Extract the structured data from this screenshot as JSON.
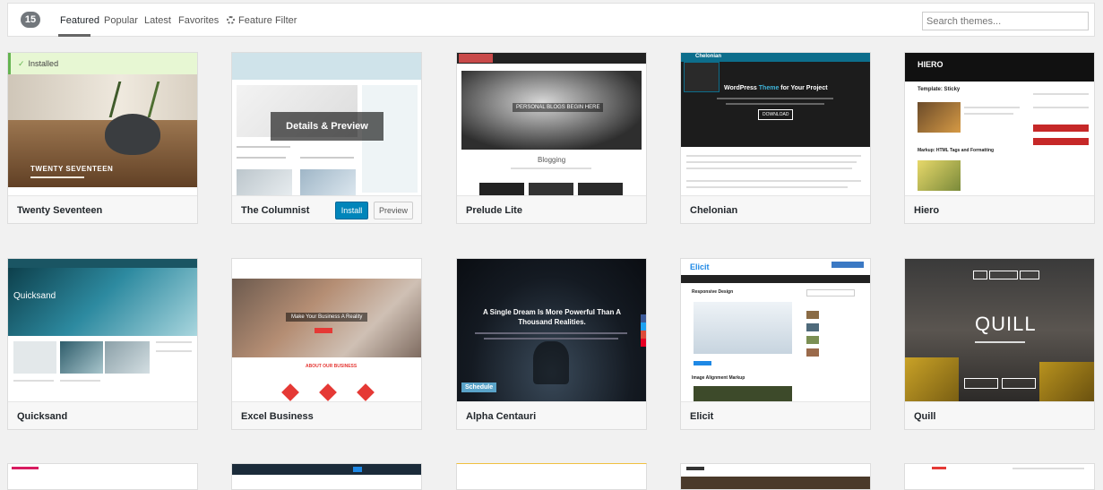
{
  "filter_bar": {
    "count": "15",
    "tabs": {
      "featured": "Featured",
      "popular": "Popular",
      "latest": "Latest",
      "favorites": "Favorites",
      "feature_filter": "Feature Filter"
    },
    "search_placeholder": "Search themes..."
  },
  "themes": [
    {
      "name": "Twenty Seventeen",
      "installed_label": "Installed",
      "thumb_title": "TWENTY SEVENTEEN"
    },
    {
      "name": "The Columnist",
      "overlay": "Details & Preview",
      "install": "Install",
      "preview": "Preview"
    },
    {
      "name": "Prelude Lite",
      "thumb_heading": "PERSONAL BLOGS BEGIN HERE",
      "thumb_sub": "Blogging"
    },
    {
      "name": "Chelonian",
      "thumb_heading_a": "WordPress ",
      "thumb_heading_b": "Theme",
      "thumb_heading_c": " for Your Project",
      "thumb_button": "DOWNLOAD",
      "thumb_logo": "Chelonian"
    },
    {
      "name": "Hiero",
      "thumb_logo": "HIERO",
      "thumb_post": "Template: Sticky",
      "thumb_post2": "Markup: HTML Tags and Formatting"
    },
    {
      "name": "Quicksand",
      "thumb_logo": "Quicksand"
    },
    {
      "name": "Excel Business",
      "thumb_heading": "Make Your Business A Reality",
      "thumb_sub": "ABOUT OUR BUSINESS"
    },
    {
      "name": "Alpha Centauri",
      "thumb_heading": "A Single Dream Is More Powerful Than A Thousand Realities.",
      "thumb_badge": "Schedule"
    },
    {
      "name": "Elicit",
      "thumb_logo": "Elicit",
      "thumb_post": "Responsive Design",
      "thumb_post2": "Image Alignment Markup"
    },
    {
      "name": "Quill",
      "thumb_logo": "QUILL"
    }
  ],
  "colors": {
    "accent": "#0085ba",
    "installed_bg": "#e7f7d3",
    "installed_check": "#64b450"
  }
}
